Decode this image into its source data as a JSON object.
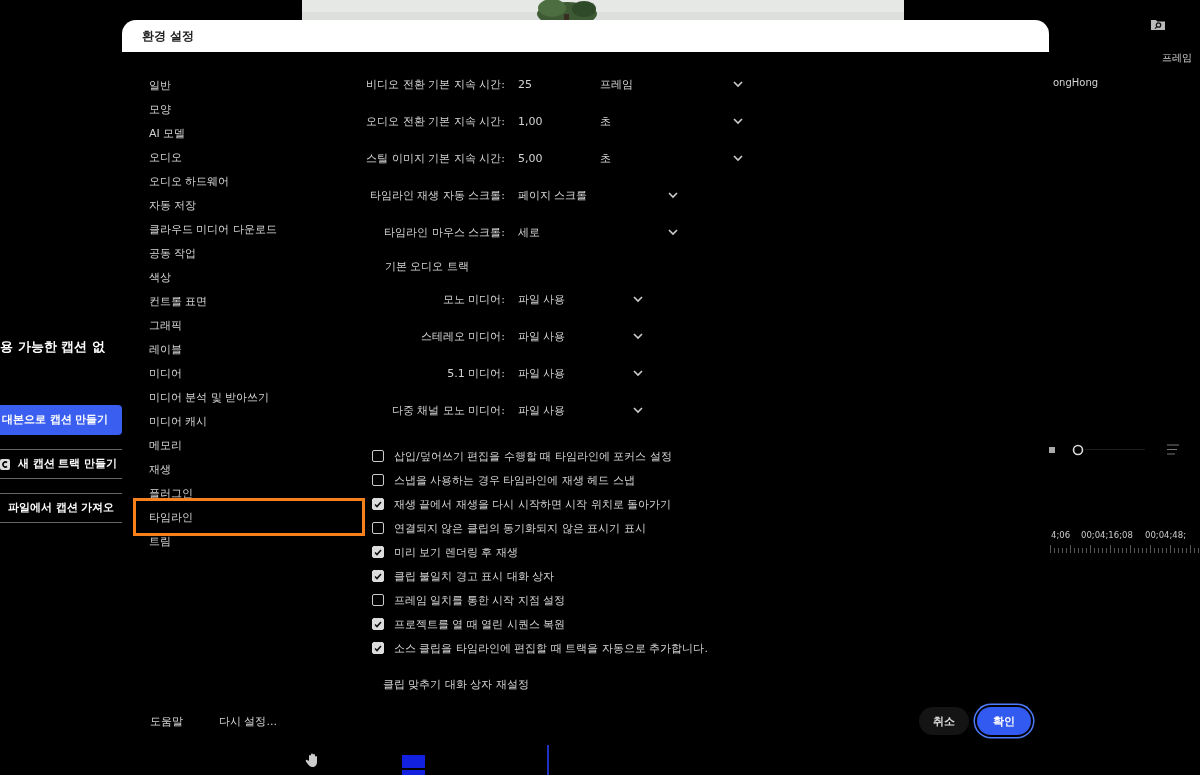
{
  "background_app": {
    "top_picture": {
      "kind": "picture"
    },
    "caption_panel": {
      "heading": "용 가능한 캡션 없",
      "buttons": [
        {
          "label": "대본으로 캡션 만들기",
          "kind": "primary"
        },
        {
          "label": "새 캡션 트랙 만들기",
          "kind": "icon"
        },
        {
          "label": "파일에서 캡션 가져오",
          "kind": "outline"
        }
      ]
    },
    "top_right_label": "프레임",
    "name_label": "ongHong",
    "timecodes": [
      "4;06",
      "00;04;16;08",
      "00;04;48;"
    ]
  },
  "dialog": {
    "title": "환경 설정",
    "sidebar": {
      "items": [
        {
          "label": "일반",
          "selected": false
        },
        {
          "label": "모양",
          "selected": false
        },
        {
          "label": "AI 모델",
          "selected": false
        },
        {
          "label": "오디오",
          "selected": false
        },
        {
          "label": "오디오 하드웨어",
          "selected": false
        },
        {
          "label": "자동 저장",
          "selected": false
        },
        {
          "label": "클라우드 미디어 다운로드",
          "selected": false
        },
        {
          "label": "공동 작업",
          "selected": false
        },
        {
          "label": "색상",
          "selected": false
        },
        {
          "label": "컨트롤 표면",
          "selected": false
        },
        {
          "label": "그래픽",
          "selected": false
        },
        {
          "label": "레이블",
          "selected": false
        },
        {
          "label": "미디어",
          "selected": false
        },
        {
          "label": "미디어 분석 및 받아쓰기",
          "selected": false
        },
        {
          "label": "미디어 캐시",
          "selected": false
        },
        {
          "label": "메모리",
          "selected": false
        },
        {
          "label": "재생",
          "selected": false
        },
        {
          "label": "플러그인",
          "selected": false
        },
        {
          "label": "타임라인",
          "selected": true
        },
        {
          "label": "트림",
          "selected": false
        }
      ]
    },
    "durations": [
      {
        "label": "비디오 전환 기본 지속 시간:",
        "value": "25",
        "unit": "프레임"
      },
      {
        "label": "오디오 전환 기본 지속 시간:",
        "value": "1,00",
        "unit": "초"
      },
      {
        "label": "스틸 이미지 기본 지속 시간:",
        "value": "5,00",
        "unit": "초"
      }
    ],
    "scrolling": [
      {
        "label": "타임라인 재생 자동 스크롤:",
        "value": "페이지 스크롤"
      },
      {
        "label": "타임라인 마우스 스크롤:",
        "value": "세로"
      }
    ],
    "audio_tracks": {
      "heading": "기본 오디오 트랙",
      "rows": [
        {
          "label": "모노 미디어:",
          "value": "파일 사용"
        },
        {
          "label": "스테레오 미디어:",
          "value": "파일 사용"
        },
        {
          "label": "5.1 미디어:",
          "value": "파일 사용"
        },
        {
          "label": "다중 채널 모노 미디어:",
          "value": "파일 사용"
        }
      ]
    },
    "checkboxes": [
      {
        "label": "삽입/덮어쓰기 편집을 수행할 때 타임라인에 포커스 설정",
        "checked": false
      },
      {
        "label": "스냅을 사용하는 경우 타임라인에 재생 헤드 스냅",
        "checked": false
      },
      {
        "label": "재생 끝에서 재생을 다시 시작하면 시작 위치로 돌아가기",
        "checked": true
      },
      {
        "label": "연결되지 않은 클립의 동기화되지 않은 표시기 표시",
        "checked": false
      },
      {
        "label": "미리 보기 렌더링 후 재생",
        "checked": true
      },
      {
        "label": "클립 불일치 경고 표시 대화 상자",
        "checked": true
      },
      {
        "label": "프레임 일치를 통한 시작 지점 설정",
        "checked": false
      },
      {
        "label": "프로젝트를 열 때 열린 시퀀스 복원",
        "checked": true
      },
      {
        "label": "소스 클립을 타임라인에 편집할 때 트랙을 자동으로 추가합니다.",
        "checked": true
      }
    ],
    "reset_dialog_button": "클립 맞추기 대화 상자 재설정",
    "footer": {
      "help": "도움말",
      "reset": "다시 설정...",
      "cancel": "취소",
      "ok": "확인"
    }
  }
}
